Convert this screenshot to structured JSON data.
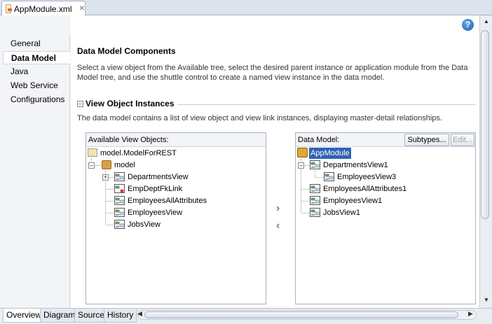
{
  "document_tab": {
    "title": "AppModule.xml",
    "close": "✕"
  },
  "help": {
    "glyph": "?"
  },
  "nav": {
    "items": [
      {
        "label": "General",
        "selected": false
      },
      {
        "label": "Data Model",
        "selected": true
      },
      {
        "label": "Java",
        "selected": false
      },
      {
        "label": "Web Service",
        "selected": false
      },
      {
        "label": "Configurations",
        "selected": false
      }
    ]
  },
  "main": {
    "title": "Data Model Components",
    "description": "Select a view object from the Available tree, select the desired parent instance or application module from the Data Model tree, and use the shuttle control to create a named view instance in the data model.",
    "section": {
      "title": "View Object Instances",
      "description": "The data model contains a list of view object and view link instances, displaying master-detail relationships."
    }
  },
  "available": {
    "header": "Available View Objects:",
    "root": "model.ModelForREST",
    "package": "model",
    "items": [
      "DepartmentsView",
      "EmpDeptFkLink",
      "EmployeesAllAttributes",
      "EmployeesView",
      "JobsView"
    ]
  },
  "data_model": {
    "header": "Data Model:",
    "subtypes_label": "Subtypes...",
    "edit_label": "Edit...",
    "root": "AppModule",
    "items": [
      "DepartmentsView1",
      "EmployeesView3",
      "EmployeesAllAttributes1",
      "EmployeesView1",
      "JobsView1"
    ]
  },
  "shuttle": {
    "add": "›",
    "remove": "‹"
  },
  "bottom_tabs": [
    "Overview",
    "Diagram",
    "Source",
    "History"
  ],
  "colors": {
    "selection": "#2f62b4",
    "chrome": "#dde3ec"
  }
}
